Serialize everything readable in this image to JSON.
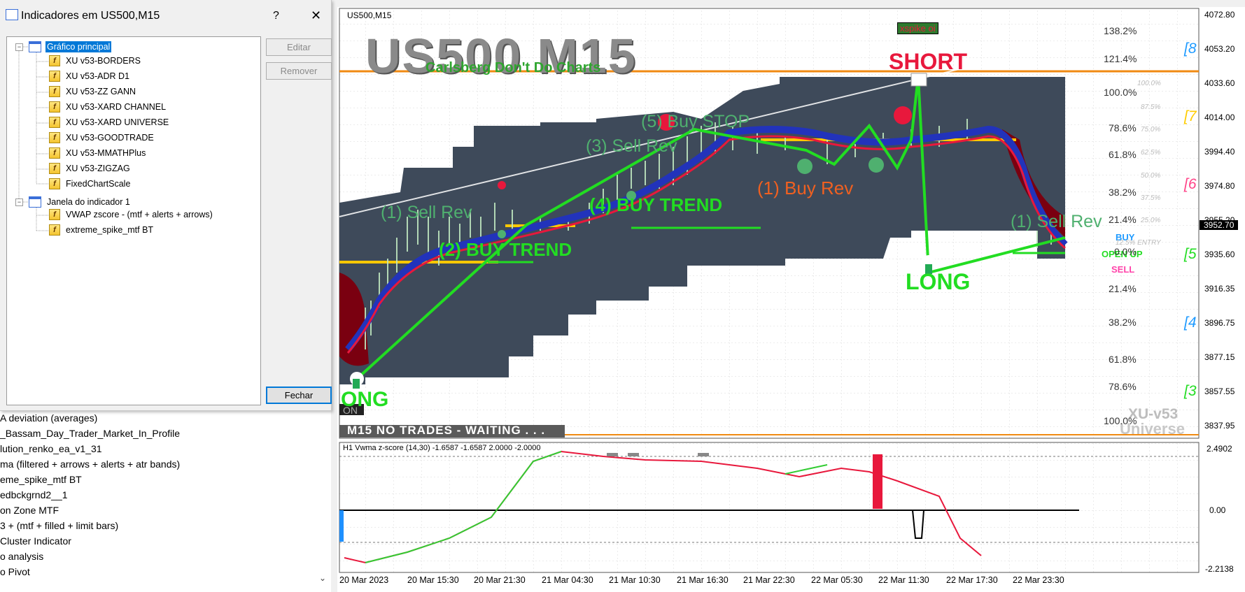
{
  "dialog": {
    "title": "Indicadores em US500,M15",
    "help": "?",
    "close": "✕",
    "tree": {
      "main_window": "Gráfico principal",
      "main_items": [
        "XU v53-BORDERS",
        "XU v53-ADR D1",
        "XU v53-ZZ GANN",
        "XU v53-XARD CHANNEL",
        "XU v53-XARD UNIVERSE",
        "XU v53-GOODTRADE",
        "XU v53-MMATHPlus",
        "XU v53-ZIGZAG",
        "FixedChartScale"
      ],
      "sub_window": "Janela do indicador 1",
      "sub_items": [
        "VWAP zscore - (mtf + alerts  + arrows)",
        "extreme_spike_mtf BT"
      ]
    },
    "buttons": {
      "edit": "Editar",
      "remove": "Remover",
      "close": "Fechar"
    }
  },
  "navigator_list": [
    "A deviation (averages)",
    "_Bassam_Day_Trader_Market_In_Profile",
    "lution_renko_ea_v1_31",
    "ma (filtered + arrows + alerts + atr bands)",
    "eme_spike_mtf BT",
    "edbckgrnd2__1",
    "on Zone MTF",
    "3 +  (mtf + filled + limit bars)",
    "Cluster Indicator",
    "o analysis",
    "o Pivot"
  ],
  "chart": {
    "symbol": "US500,M15",
    "big_title": "US500 M15",
    "subtitle": "Carlsberg Don't Do Charts",
    "status_bar": "M15  NO TRADES - WAITING . . .",
    "spike_box": "xspike oi",
    "watermark": [
      "XU-v53",
      "Universe"
    ],
    "labels": {
      "short": "SHORT",
      "long_right": "LONG",
      "long_left": "ONG",
      "on": "ON",
      "buy_stop": "(5) Buy STOP",
      "sell_rev3": "(3) Sell Rev",
      "sell_rev1_left": "(1) Sell Rev",
      "buy_trend2": "(2) BUY TREND",
      "buy_trend4": "(4) BUY TREND",
      "buy_rev1": "(1) Buy Rev",
      "sell_rev1_right": "(1) Sell Rev",
      "buy": "BUY",
      "open_up": "OPEN UP",
      "sell": "SELL",
      "entry": "12.5% ENTRY"
    },
    "fib_levels": [
      "138.2%",
      "121.4%",
      "100.0%",
      "78.6%",
      "61.8%",
      "38.2%",
      "21.4%",
      "0.0%",
      "21.4%",
      "38.2%",
      "61.8%",
      "78.6%",
      "100.0%"
    ],
    "fib_small": [
      "100.0%",
      "87.5%",
      "75.0%",
      "62.5%",
      "50.0%",
      "37.5%",
      "25.0%"
    ],
    "gann": [
      "[8",
      "[7",
      "[6",
      "[5",
      "[4",
      "[3"
    ],
    "price_scale": [
      "4072.80",
      "4053.20",
      "4033.60",
      "4014.00",
      "3994.40",
      "3974.80",
      "3955.20",
      "3935.60",
      "3916.35",
      "3896.75",
      "3877.15",
      "3857.55",
      "3837.95"
    ],
    "current_price": "3952.70",
    "indicator": {
      "header": "H1 Vwma z-score (14,30) -1.6587 -1.6587 2.0000 -2.0000",
      "scale": [
        "2.4902",
        "0.00",
        "-2.2138"
      ]
    },
    "time_axis": [
      "20 Mar 2023",
      "20 Mar 15:30",
      "20 Mar 21:30",
      "21 Mar 04:30",
      "21 Mar 10:30",
      "21 Mar 16:30",
      "21 Mar 22:30",
      "22 Mar 05:30",
      "22 Mar 11:30",
      "22 Mar 17:30",
      "22 Mar 23:30"
    ],
    "colors": {
      "bg": "#ffffff",
      "range": "#3e4a5a",
      "green": "#22dd22",
      "red": "#e8183c",
      "orange": "#f08a12",
      "yellow": "#ffc800"
    }
  }
}
